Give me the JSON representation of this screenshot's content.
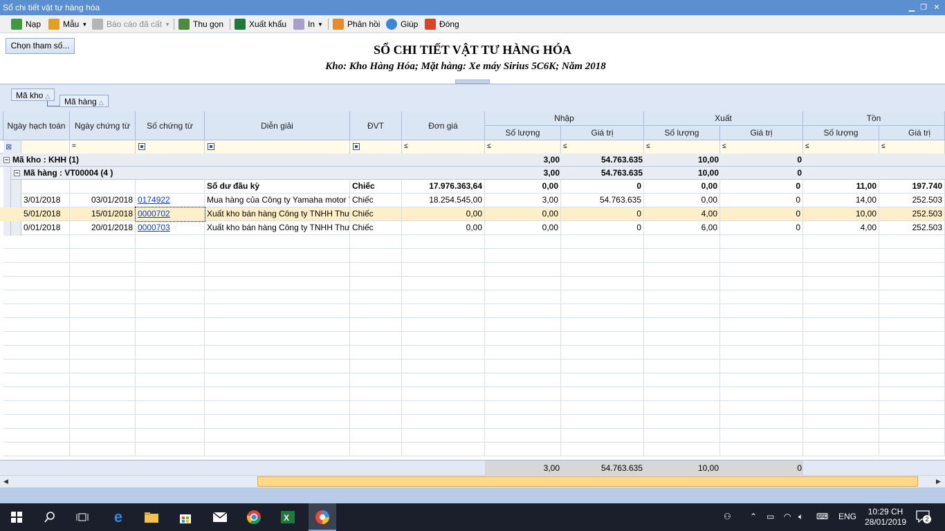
{
  "window": {
    "title": "Sổ chi tiết vật tư hàng hóa"
  },
  "toolbar": {
    "nap": "Nạp",
    "mau": "Mẫu",
    "bao_cao_da_cat": "Báo cáo đã cất",
    "thu_gon": "Thu gọn",
    "xuat_khau": "Xuất khẩu",
    "in": "In",
    "phan_hoi": "Phản hồi",
    "giup": "Giúp",
    "dong": "Đóng"
  },
  "params_button": "Chọn tham số...",
  "report": {
    "title": "SỔ CHI TIẾT VẬT TƯ HÀNG HÓA",
    "subtitle": "Kho: Kho Hàng Hóa; Mặt hàng: Xe máy Sirius 5C6K; Năm 2018"
  },
  "group_panel": {
    "chip1": "Mã kho",
    "chip2": "Mã hàng"
  },
  "columns": {
    "ngay_hach_toan": "Ngày hạch toán",
    "ngay_chung_tu": "Ngày chứng từ",
    "so_chung_tu": "Số chứng từ",
    "dien_giai": "Diễn giải",
    "dvt": "ĐVT",
    "don_gia": "Đơn giá",
    "nhap": "Nhập",
    "xuat": "Xuất",
    "ton": "Tồn",
    "so_luong": "Số lượng",
    "gia_tri": "Giá trị"
  },
  "filter_ops": {
    "eq": "=",
    "le": "≤"
  },
  "group1": {
    "label": "Mã kho : KHH (1)",
    "nhap_sl": "3,00",
    "nhap_gt": "54.763.635",
    "xuat_sl": "10,00",
    "xuat_gt": "0"
  },
  "group2": {
    "label": "Mã hàng : VT00004 (4 )",
    "nhap_sl": "3,00",
    "nhap_gt": "54.763.635",
    "xuat_sl": "10,00",
    "xuat_gt": "0"
  },
  "rows": [
    {
      "nht": "",
      "nct": "",
      "sct": "",
      "dg": "Số dư đầu kỳ",
      "dvt": "Chiếc",
      "don_gia": "17.976.363,64",
      "nsl": "0,00",
      "ngt": "0",
      "xsl": "0,00",
      "xgt": "0",
      "tsl": "11,00",
      "tgt": "197.740"
    },
    {
      "nht": "3/01/2018",
      "nct": "03/01/2018",
      "sct": "0174922",
      "dg": "Mua hàng của Công ty Yamaha motor V",
      "dvt": "Chiếc",
      "don_gia": "18.254.545,00",
      "nsl": "3,00",
      "ngt": "54.763.635",
      "xsl": "0,00",
      "xgt": "0",
      "tsl": "14,00",
      "tgt": "252.503"
    },
    {
      "nht": "5/01/2018",
      "nct": "15/01/2018",
      "sct": "0000702",
      "dg": "Xuất kho bán hàng Công ty TNHH Thươ",
      "dvt": "Chiếc",
      "don_gia": "0,00",
      "nsl": "0,00",
      "ngt": "0",
      "xsl": "4,00",
      "xgt": "0",
      "tsl": "10,00",
      "tgt": "252.503"
    },
    {
      "nht": "0/01/2018",
      "nct": "20/01/2018",
      "sct": "0000703",
      "dg": "Xuất kho bán hàng Công ty TNHH Thươ",
      "dvt": "Chiếc",
      "don_gia": "0,00",
      "nsl": "0,00",
      "ngt": "0",
      "xsl": "6,00",
      "xgt": "0",
      "tsl": "4,00",
      "tgt": "252.503"
    }
  ],
  "footer": {
    "nhap_sl": "3,00",
    "nhap_gt": "54.763.635",
    "xuat_sl": "10,00",
    "xuat_gt": "0"
  },
  "taskbar": {
    "lang": "ENG",
    "time": "10:29 CH",
    "date": "28/01/2019",
    "notifications": "2"
  },
  "colors": {
    "accent": "#5b8fd0",
    "selected_row": "#fdf0c8",
    "header": "#dbe6f5"
  }
}
